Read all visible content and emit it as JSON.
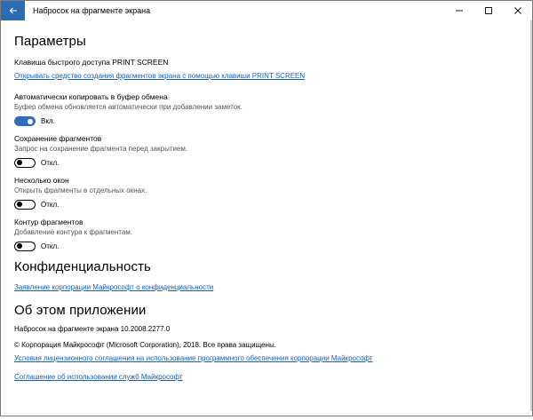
{
  "window": {
    "title": "Набросок на фрагменте экрана",
    "accent": "#2b6cb5",
    "icons": [
      "back-arrow-icon",
      "minimize-icon",
      "maximize-icon",
      "close-icon"
    ]
  },
  "parameters": {
    "heading": "Параметры",
    "print_screen": {
      "label": "Клавиша быстрого доступа PRINT SCREEN",
      "link": "Открывать средство создания фрагментов экрана с помощью клавиши PRINT SCREEN"
    },
    "auto_copy": {
      "label": "Автоматически копировать в буфер обмена",
      "desc": "Буфер обмена обновляется автоматически при добавлении заметок.",
      "state": "Вкл.",
      "on": true
    },
    "save_fragments": {
      "label": "Сохранение фрагментов",
      "desc": "Запрос на сохранение фрагмента перед закрытием.",
      "state": "Откл.",
      "on": false
    },
    "multiple_windows": {
      "label": "Несколько окон",
      "desc": "Открыть фрагменты в отдельных окнах.",
      "state": "Откл.",
      "on": false
    },
    "outline": {
      "label": "Контур фрагментов",
      "desc": "Добавление контура к фрагментам.",
      "state": "Откл.",
      "on": false
    }
  },
  "privacy": {
    "heading": "Конфиденциальность",
    "link": "Заявление корпорации Майкрософт о конфиденциальности"
  },
  "about": {
    "heading": "Об этом приложении",
    "version": "Набросок на фрагменте экрана 10.2008.2277.0",
    "copyright": "© Корпорация Майкрософт (Microsoft Corporation), 2018. Все права защищены.",
    "license_link": "Условия лицензионного соглашения на использование программного обеспечения корпорации Майкрософт",
    "services_link": "Соглашение об использовании служб Майкрософт"
  }
}
